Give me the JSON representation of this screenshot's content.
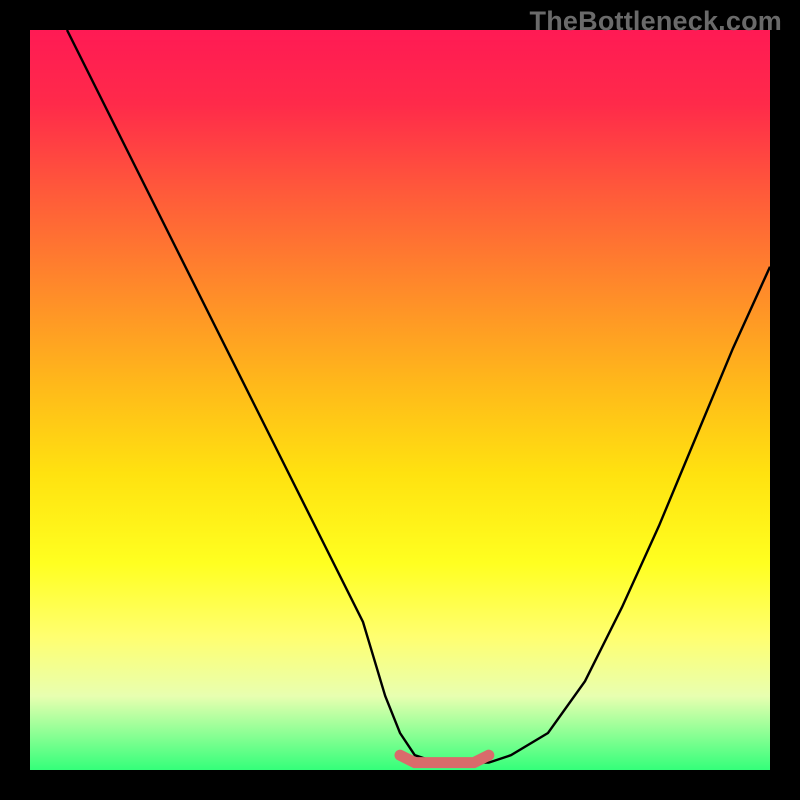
{
  "watermark": "TheBottleneck.com",
  "chart_data": {
    "type": "line",
    "title": "",
    "xlabel": "",
    "ylabel": "",
    "xlim": [
      0,
      100
    ],
    "ylim": [
      0,
      100
    ],
    "grid": false,
    "series": [
      {
        "name": "curve",
        "x": [
          5,
          10,
          15,
          20,
          25,
          30,
          35,
          40,
          45,
          48,
          50,
          52,
          55,
          58,
          60,
          62,
          65,
          70,
          75,
          80,
          85,
          90,
          95,
          100
        ],
        "values": [
          100,
          90,
          80,
          70,
          60,
          50,
          40,
          30,
          20,
          10,
          5,
          2,
          1,
          1,
          1,
          1,
          2,
          5,
          12,
          22,
          33,
          45,
          57,
          68
        ]
      },
      {
        "name": "highlight",
        "x": [
          50,
          52,
          54,
          56,
          58,
          60,
          62
        ],
        "values": [
          2,
          1,
          1,
          1,
          1,
          1,
          2
        ]
      }
    ],
    "colors": {
      "curve": "#000000",
      "highlight": "#d96b6b"
    }
  }
}
